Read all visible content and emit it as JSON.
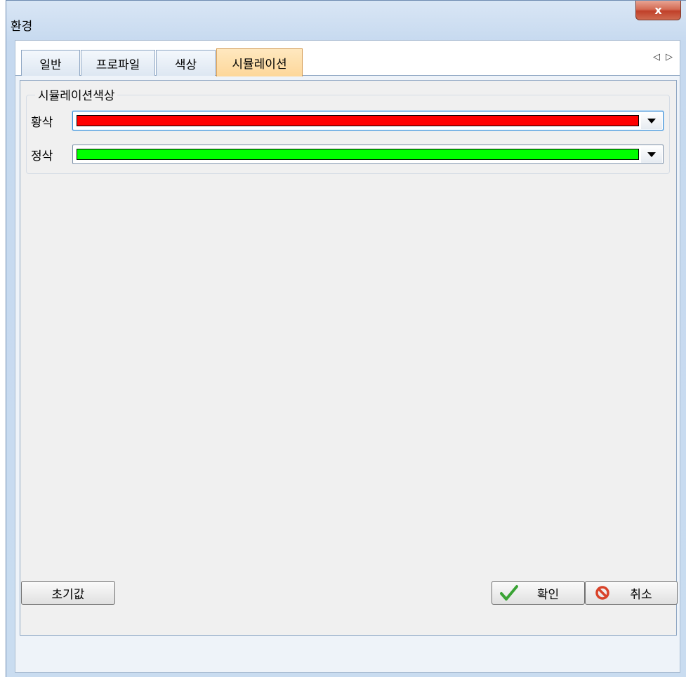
{
  "window": {
    "title": "환경",
    "close_label": "x"
  },
  "tabs": [
    {
      "label": "일반",
      "active": false
    },
    {
      "label": "프로파일",
      "active": false
    },
    {
      "label": "색상",
      "active": false
    },
    {
      "label": "시뮬레이션",
      "active": true
    }
  ],
  "tab_scroll": {
    "left": "◁",
    "right": "▷"
  },
  "simulation_colors": {
    "group_label": "시뮬레이션색상",
    "rows": [
      {
        "label": "황삭",
        "color": "#ff0000"
      },
      {
        "label": "정삭",
        "color": "#00ff00"
      }
    ]
  },
  "buttons": {
    "reset": "초기값",
    "ok": "확인",
    "cancel": "취소"
  }
}
